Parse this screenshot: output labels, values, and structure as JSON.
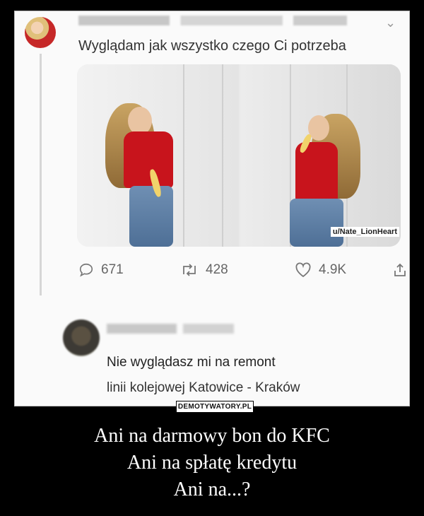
{
  "tweet": {
    "text": "Wyglądam jak wszystko czego Ci potrzeba",
    "photo_credit": "u/Nate_LionHeart",
    "stats": {
      "replies": "671",
      "retweets": "428",
      "likes": "4.9K"
    }
  },
  "reply": {
    "line1": "Nie wyglądasz mi na remont",
    "line2": "linii kolejowej Katowice - Kraków"
  },
  "badge": "DEMOTYWATORY.PL",
  "caption": [
    "Ani na darmowy bon do KFC",
    "Ani na spłatę kredytu",
    "Ani na...?"
  ],
  "icons": [
    "reply-icon",
    "retweet-icon",
    "like-icon",
    "share-icon",
    "chevron-down-icon"
  ]
}
